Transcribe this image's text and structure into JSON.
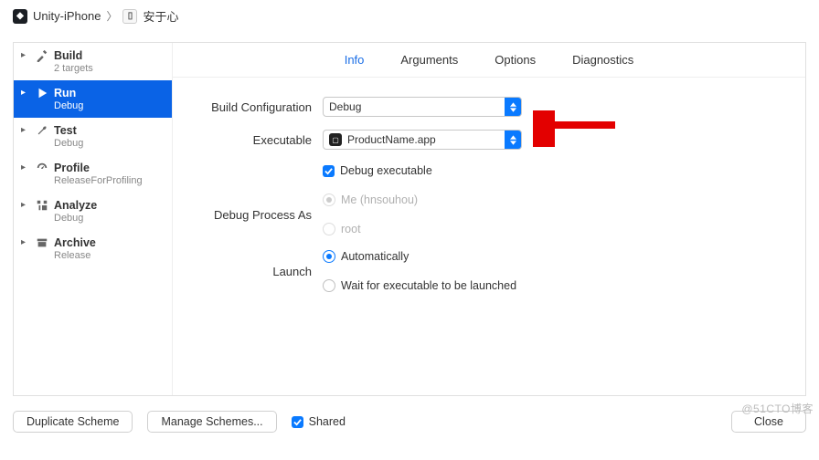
{
  "breadcrumb": {
    "project": "Unity-iPhone",
    "target": "安于心"
  },
  "sidebar": [
    {
      "label": "Build",
      "sub": "2 targets"
    },
    {
      "label": "Run",
      "sub": "Debug"
    },
    {
      "label": "Test",
      "sub": "Debug"
    },
    {
      "label": "Profile",
      "sub": "ReleaseForProfiling"
    },
    {
      "label": "Analyze",
      "sub": "Debug"
    },
    {
      "label": "Archive",
      "sub": "Release"
    }
  ],
  "tabs": {
    "info": "Info",
    "arguments": "Arguments",
    "options": "Options",
    "diagnostics": "Diagnostics"
  },
  "form": {
    "buildConfig": {
      "label": "Build Configuration",
      "value": "Debug"
    },
    "executable": {
      "label": "Executable",
      "value": "ProductName.app"
    },
    "debugExec": {
      "label": "Debug executable"
    },
    "debugProcessAs": {
      "label": "Debug Process As",
      "me": "Me (hnsouhou)",
      "root": "root"
    },
    "launch": {
      "label": "Launch",
      "auto": "Automatically",
      "wait": "Wait for executable to be launched"
    }
  },
  "bottom": {
    "duplicate": "Duplicate Scheme",
    "manage": "Manage Schemes...",
    "shared": "Shared",
    "close": "Close"
  },
  "watermark": "@51CTO博客"
}
